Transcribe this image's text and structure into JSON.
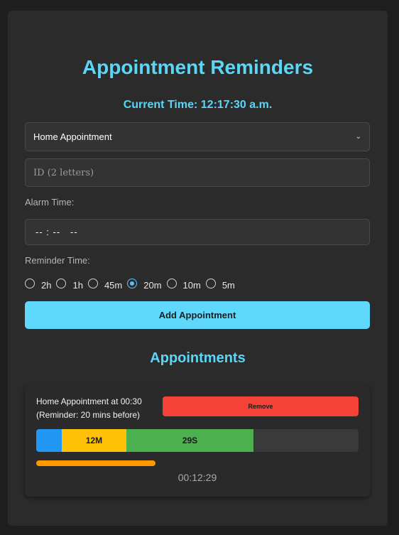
{
  "header": {
    "title": "Appointment Reminders",
    "current_time": "Current Time: 12:17:30 a.m."
  },
  "form": {
    "appointment_type": "Home Appointment",
    "id_placeholder": "ID (2 letters)",
    "alarm_label": "Alarm Time:",
    "alarm_time_value": "-- : --   --",
    "reminder_label": "Reminder Time:",
    "reminder_options": [
      "2h",
      "1h",
      "45m",
      "20m",
      "10m",
      "5m"
    ],
    "reminder_selected": "20m",
    "add_button": "Add Appointment"
  },
  "appointments": {
    "title": "Appointments",
    "items": [
      {
        "line1": "Home Appointment at 00:30",
        "line2": "(Reminder: 20 mins before)",
        "remove_label": "Remove",
        "minutes_label": "12M",
        "seconds_label": "29S",
        "countdown": "00:12:29",
        "progress_fraction": 0.37
      }
    ]
  },
  "colors": {
    "accent": "#5cd6f7",
    "remove": "#f44336",
    "seg_blue": "#2196f3",
    "seg_yellow": "#ffc107",
    "seg_green": "#4caf50",
    "progress": "#ff9800"
  },
  "icons": {
    "select_arrow": "chevron-down-icon"
  }
}
